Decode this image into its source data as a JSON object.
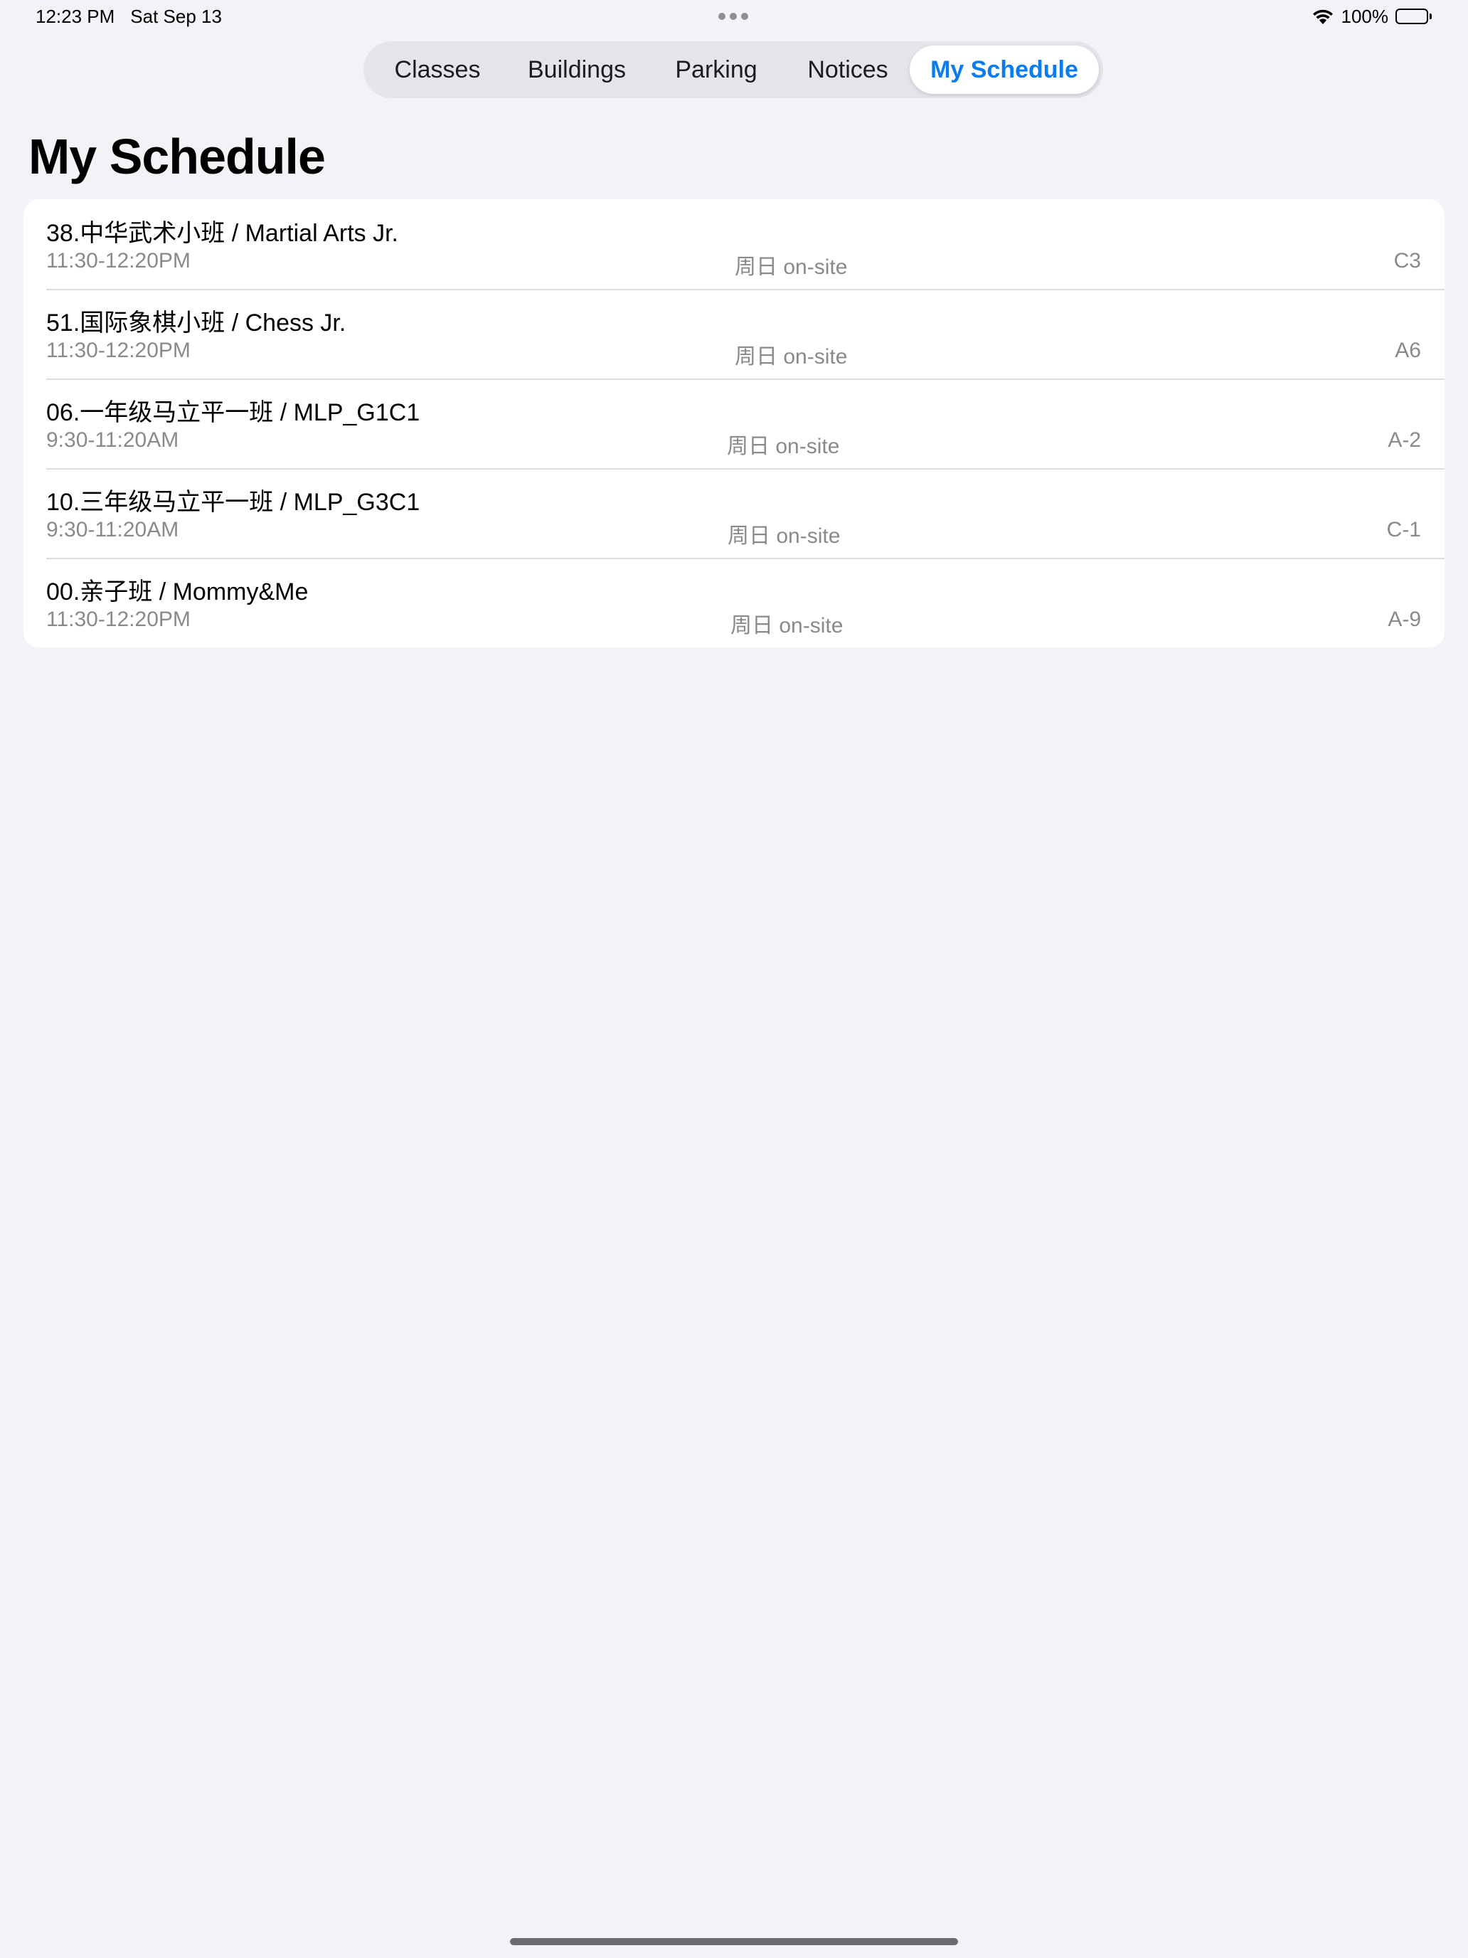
{
  "status_bar": {
    "time": "12:23 PM",
    "date": "Sat Sep 13",
    "battery_percent": "100%",
    "icons": [
      "more-dots-icon",
      "wifi-icon",
      "battery-icon"
    ]
  },
  "tabs": [
    {
      "label": "Classes",
      "selected": false
    },
    {
      "label": "Buildings",
      "selected": false
    },
    {
      "label": "Parking",
      "selected": false
    },
    {
      "label": "Notices",
      "selected": false
    },
    {
      "label": "My Schedule",
      "selected": true
    }
  ],
  "page": {
    "title": "My Schedule"
  },
  "schedule": [
    {
      "title": "38.中华武术小班 / Martial Arts Jr.",
      "time": "11:30-12:20PM",
      "day": "周日 on-site",
      "room": "C3"
    },
    {
      "title": "51.国际象棋小班 / Chess Jr.",
      "time": "11:30-12:20PM",
      "day": "周日 on-site",
      "room": "A6"
    },
    {
      "title": "06.一年级马立平一班 / MLP_G1C1",
      "time": "9:30-11:20AM",
      "day": "周日 on-site",
      "room": "A-2"
    },
    {
      "title": "10.三年级马立平一班 / MLP_G3C1",
      "time": "9:30-11:20AM",
      "day": "周日 on-site",
      "room": "C-1"
    },
    {
      "title": "00.亲子班 / Mommy&Me",
      "time": "11:30-12:20PM",
      "day": "周日 on-site",
      "room": "A-9"
    }
  ],
  "colors": {
    "accent": "#0a7cf0",
    "background": "#f2f2f7",
    "secondary_text": "#8a8a8e"
  }
}
